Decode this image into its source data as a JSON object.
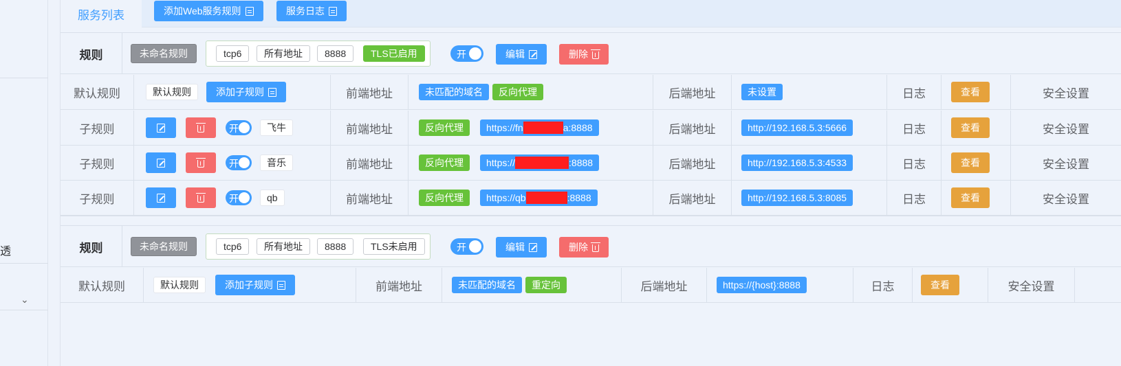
{
  "topbar": {
    "tab_label": "服务列表",
    "add_web_rule_label": "添加Web服务规则",
    "service_log_label": "服务日志"
  },
  "sidebar": {
    "clipped_text": "透"
  },
  "rules": [
    {
      "head_label": "规则",
      "name": "未命名规则",
      "protocol": "tcp6",
      "address": "所有地址",
      "port": "8888",
      "tls": "TLS已启用",
      "toggle": "开",
      "edit_label": "编辑",
      "delete_label": "删除",
      "default_row": {
        "label": "默认规则",
        "tag": "默认规则",
        "add_sub_label": "添加子规则",
        "frontend_label": "前端地址",
        "frontend_tag1": "未匹配的域名",
        "frontend_tag2": "反向代理",
        "backend_label": "后端地址",
        "backend_value": "未设置",
        "log_label": "日志",
        "view_label": "查看",
        "security_label": "安全设置"
      },
      "sub_rows": [
        {
          "label": "子规则",
          "toggle": "开",
          "name": "飞牛",
          "frontend_label": "前端地址",
          "mode": "反向代理",
          "url_prefix": "https://fn",
          "url_suffix": "a:8888",
          "backend_label": "后端地址",
          "backend": "http://192.168.5.3:5666",
          "log_label": "日志",
          "view_label": "查看",
          "security_label": "安全设置"
        },
        {
          "label": "子规则",
          "toggle": "开",
          "name": "音乐",
          "frontend_label": "前端地址",
          "mode": "反向代理",
          "url_prefix": "https://",
          "url_suffix": ":8888",
          "backend_label": "后端地址",
          "backend": "http://192.168.5.3:4533",
          "log_label": "日志",
          "view_label": "查看",
          "security_label": "安全设置"
        },
        {
          "label": "子规则",
          "toggle": "开",
          "name": "qb",
          "frontend_label": "前端地址",
          "mode": "反向代理",
          "url_prefix": "https://qb",
          "url_suffix": ":8888",
          "backend_label": "后端地址",
          "backend": "http://192.168.5.3:8085",
          "log_label": "日志",
          "view_label": "查看",
          "security_label": "安全设置"
        }
      ]
    },
    {
      "head_label": "规则",
      "name": "未命名规则",
      "protocol": "tcp6",
      "address": "所有地址",
      "port": "8888",
      "tls": "TLS未启用",
      "toggle": "开",
      "edit_label": "编辑",
      "delete_label": "删除",
      "default_row": {
        "label": "默认规则",
        "tag": "默认规则",
        "add_sub_label": "添加子规则",
        "frontend_label": "前端地址",
        "frontend_tag1": "未匹配的域名",
        "frontend_tag2": "重定向",
        "backend_label": "后端地址",
        "backend_value": "https://{host}:8888",
        "log_label": "日志",
        "view_label": "查看",
        "security_label": "安全设置"
      }
    }
  ]
}
